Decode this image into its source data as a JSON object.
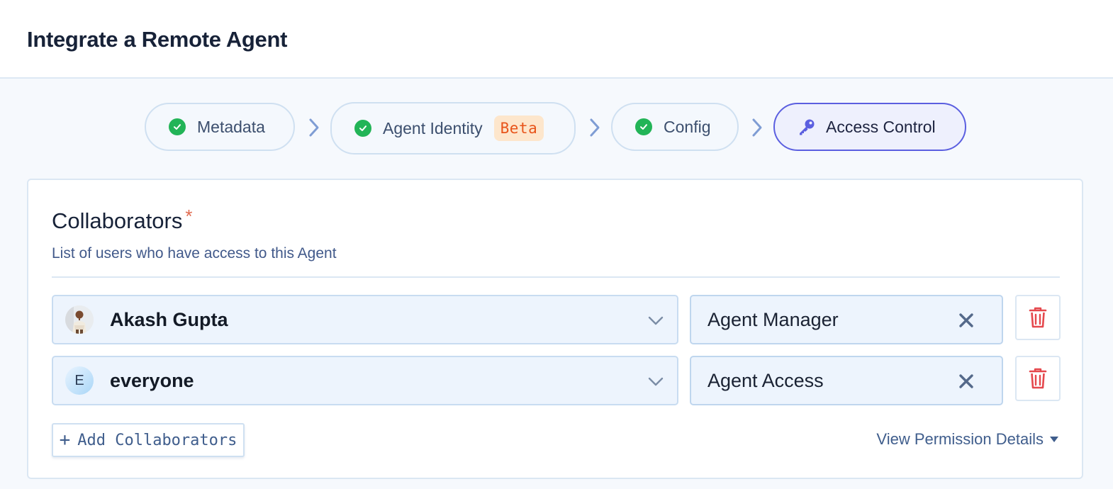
{
  "page": {
    "title": "Integrate a Remote Agent"
  },
  "stepper": {
    "steps": [
      {
        "label": "Metadata",
        "status": "complete"
      },
      {
        "label": "Agent Identity",
        "badge": "Beta",
        "status": "complete"
      },
      {
        "label": "Config",
        "status": "complete"
      },
      {
        "label": "Access Control",
        "status": "active",
        "icon": "key-icon"
      }
    ]
  },
  "collaborators": {
    "title": "Collaborators",
    "required_marker": "*",
    "subtitle": "List of users who have access to this Agent",
    "rows": [
      {
        "user": "Akash Gupta",
        "avatar": "photo",
        "role": "Agent Manager"
      },
      {
        "user": "everyone",
        "avatar_letter": "E",
        "role": "Agent Access"
      }
    ],
    "add_label": "Add Collaborators",
    "add_icon": "+",
    "view_permissions_label": "View Permission Details"
  },
  "colors": {
    "accent": "#5b5fe0",
    "success": "#22b457",
    "danger": "#e5484d",
    "beta_bg": "#fde6cc",
    "beta_text": "#e8541a"
  }
}
